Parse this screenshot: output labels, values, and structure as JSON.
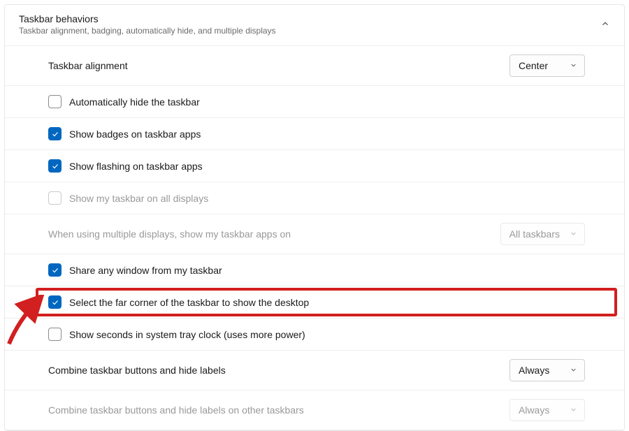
{
  "header": {
    "title": "Taskbar behaviors",
    "subtitle": "Taskbar alignment, badging, automatically hide, and multiple displays"
  },
  "rows": {
    "alignment": {
      "label": "Taskbar alignment",
      "value": "Center"
    },
    "autohide": {
      "label": "Automatically hide the taskbar"
    },
    "badges": {
      "label": "Show badges on taskbar apps"
    },
    "flashing": {
      "label": "Show flashing on taskbar apps"
    },
    "all_displays": {
      "label": "Show my taskbar on all displays"
    },
    "multi_where": {
      "label": "When using multiple displays, show my taskbar apps on",
      "value": "All taskbars"
    },
    "share_window": {
      "label": "Share any window from my taskbar"
    },
    "far_corner": {
      "label": "Select the far corner of the taskbar to show the desktop"
    },
    "seconds": {
      "label": "Show seconds in system tray clock (uses more power)"
    },
    "combine": {
      "label": "Combine taskbar buttons and hide labels",
      "value": "Always"
    },
    "combine_other": {
      "label": "Combine taskbar buttons and hide labels on other taskbars",
      "value": "Always"
    }
  }
}
